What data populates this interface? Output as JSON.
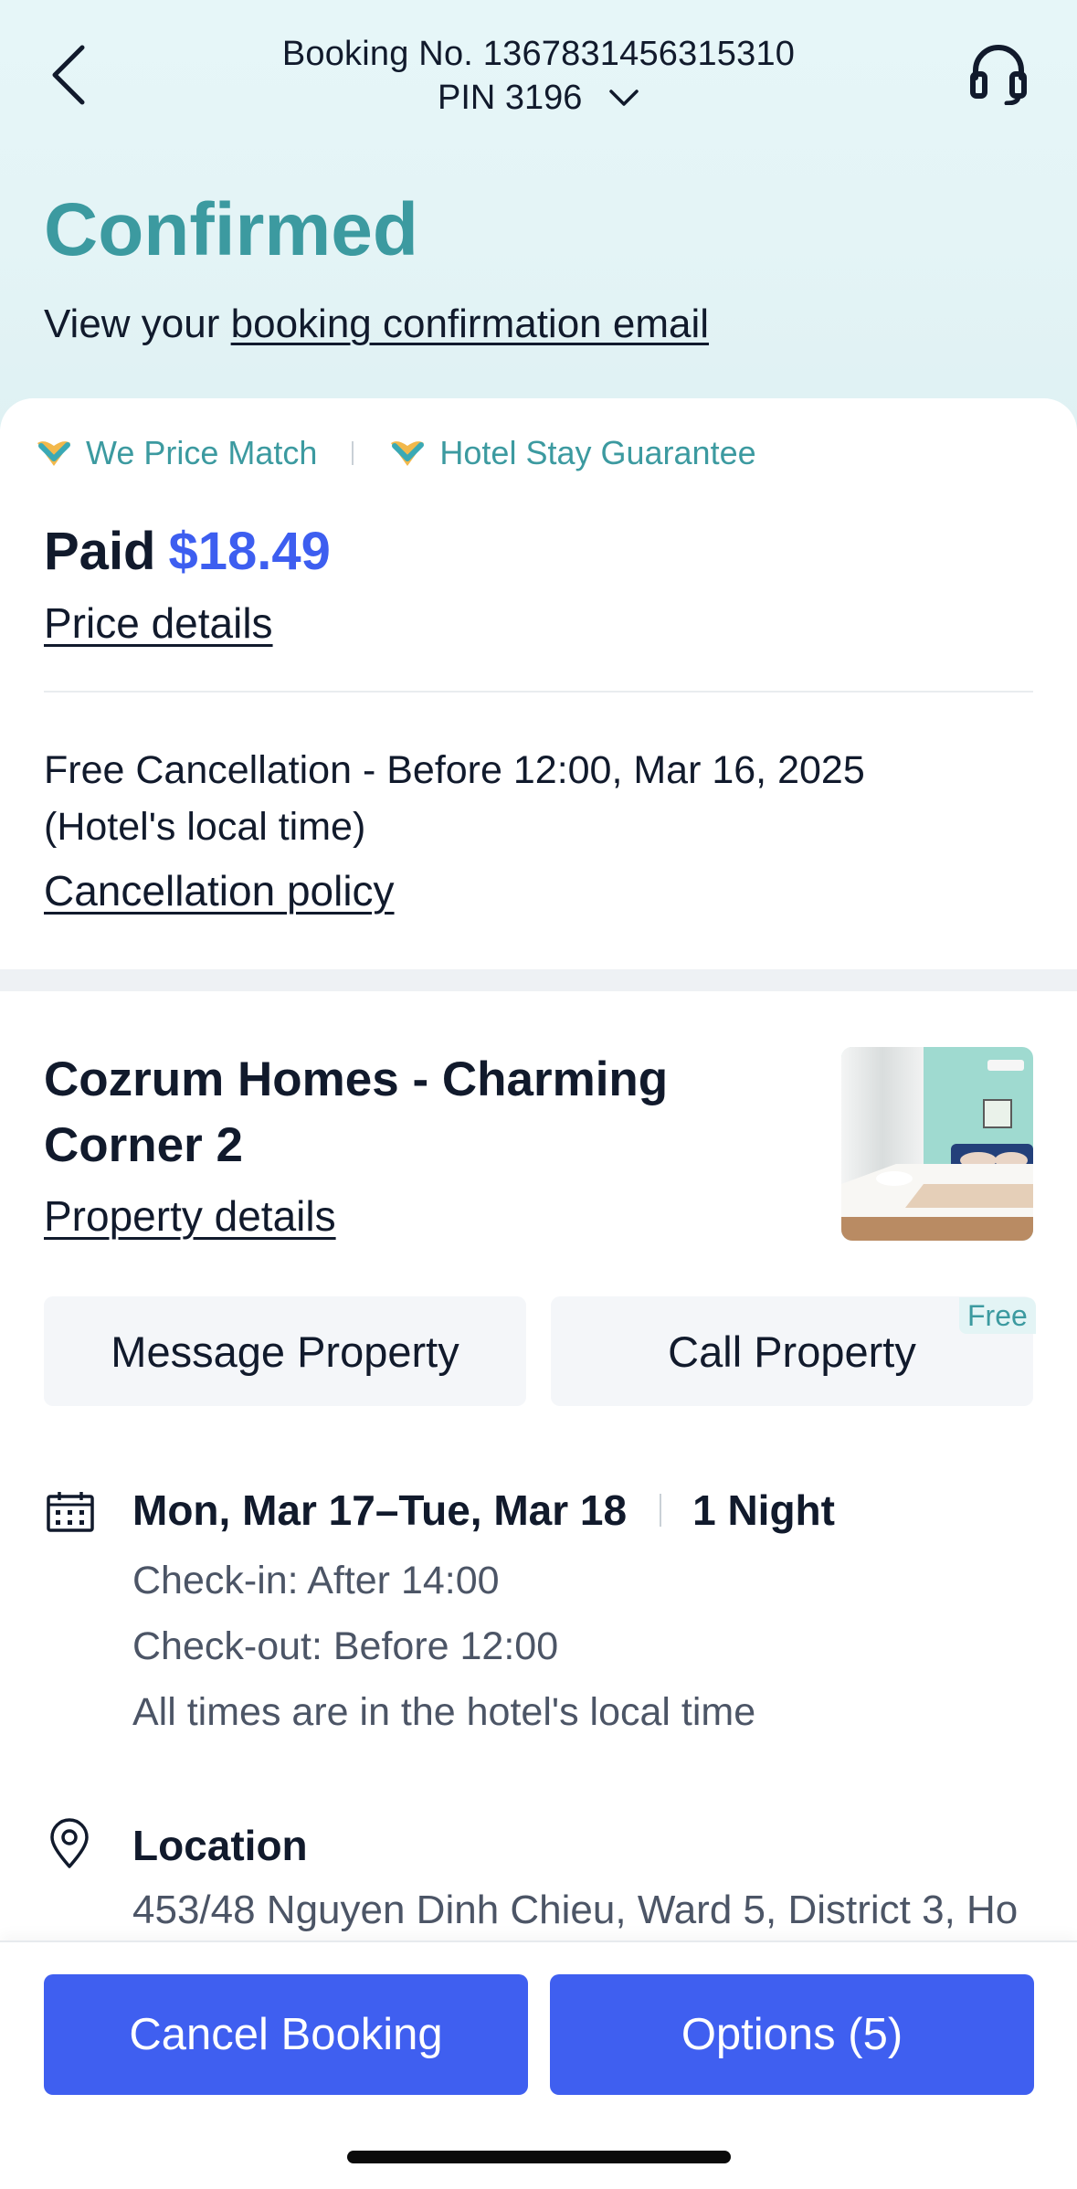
{
  "header": {
    "booking_number": "Booking No. 1367831456315310",
    "pin": "PIN 3196",
    "status": "Confirmed",
    "email_prefix": "View your ",
    "email_link": "booking confirmation email"
  },
  "guarantees": {
    "price_match": "We Price Match",
    "stay_guarantee": "Hotel Stay Guarantee"
  },
  "payment": {
    "paid_label": "Paid",
    "amount": "$18.49",
    "price_details_link": "Price details"
  },
  "cancellation": {
    "line1": "Free Cancellation - Before 12:00, Mar 16, 2025",
    "line2": "(Hotel's local time)",
    "policy_link": "Cancellation policy"
  },
  "property": {
    "name": "Cozrum Homes - Charming Corner 2",
    "details_link": "Property details",
    "message_button": "Message Property",
    "call_button": "Call Property",
    "free_tag": "Free"
  },
  "stay": {
    "dates": "Mon, Mar 17–Tue, Mar 18",
    "nights": "1 Night",
    "checkin": "Check-in: After 14:00",
    "checkout": "Check-out: Before 12:00",
    "times_note": "All times are in the hotel's local time"
  },
  "location": {
    "title": "Location",
    "address": "453/48 Nguyen Dinh Chieu, Ward 5, District 3, Ho"
  },
  "actions": {
    "cancel_booking": "Cancel Booking",
    "options": "Options (5)"
  },
  "colors": {
    "accent_teal": "#3c9aa0",
    "primary_blue": "#3f5ff0",
    "price_blue": "#3d5ef0"
  }
}
